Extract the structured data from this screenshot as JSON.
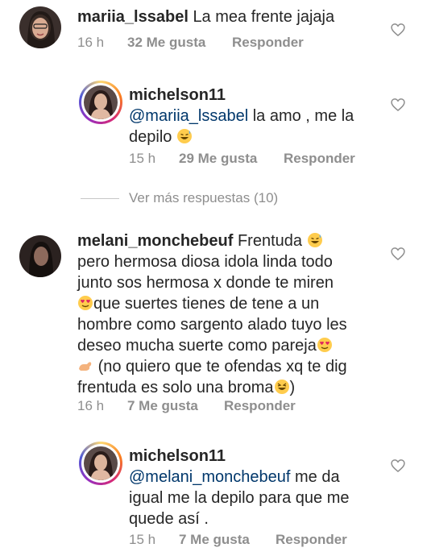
{
  "comments": [
    {
      "username": "mariia_lssabel",
      "text": "La mea frente jajaja",
      "time": "16 h",
      "likes": "32 Me gusta",
      "reply": "Responder"
    },
    {
      "username": "michelson11",
      "mention": "@mariia_lssabel",
      "text_line1": "la amo , me la",
      "text_line2": "depilo",
      "time": "15 h",
      "likes": "29 Me gusta",
      "reply": "Responder"
    },
    {
      "username": "melani_monchebeuf",
      "text_line1": "Frentuda",
      "text_line2": "pero hermosa diosa idola linda todo",
      "text_line3": "junto sos hermosa x donde te miren",
      "text_line4": "que suertes tienes de tene a un",
      "text_line5": "hombre como sargento alado tuyo les",
      "text_line6": "deseo mucha suerte como pareja",
      "text_line7": "(no quiero que te ofendas xq te dig",
      "text_line8": "frentuda es solo una broma",
      "text_line8_end": ")",
      "time": "16 h",
      "likes": "7 Me gusta",
      "reply": "Responder"
    },
    {
      "username": "michelson11",
      "mention": "@melani_monchebeuf",
      "text_line1": "me da",
      "text_line2": "igual me la depilo para que me",
      "text_line3": "quede así .",
      "time": "15 h",
      "likes": "7 Me gusta",
      "reply": "Responder"
    }
  ],
  "view_more": "Ver más respuestas (10)",
  "colors": {
    "text": "#262626",
    "meta": "#8e8e8e",
    "mention": "#00376b",
    "emoji": "#ffcc4d"
  }
}
